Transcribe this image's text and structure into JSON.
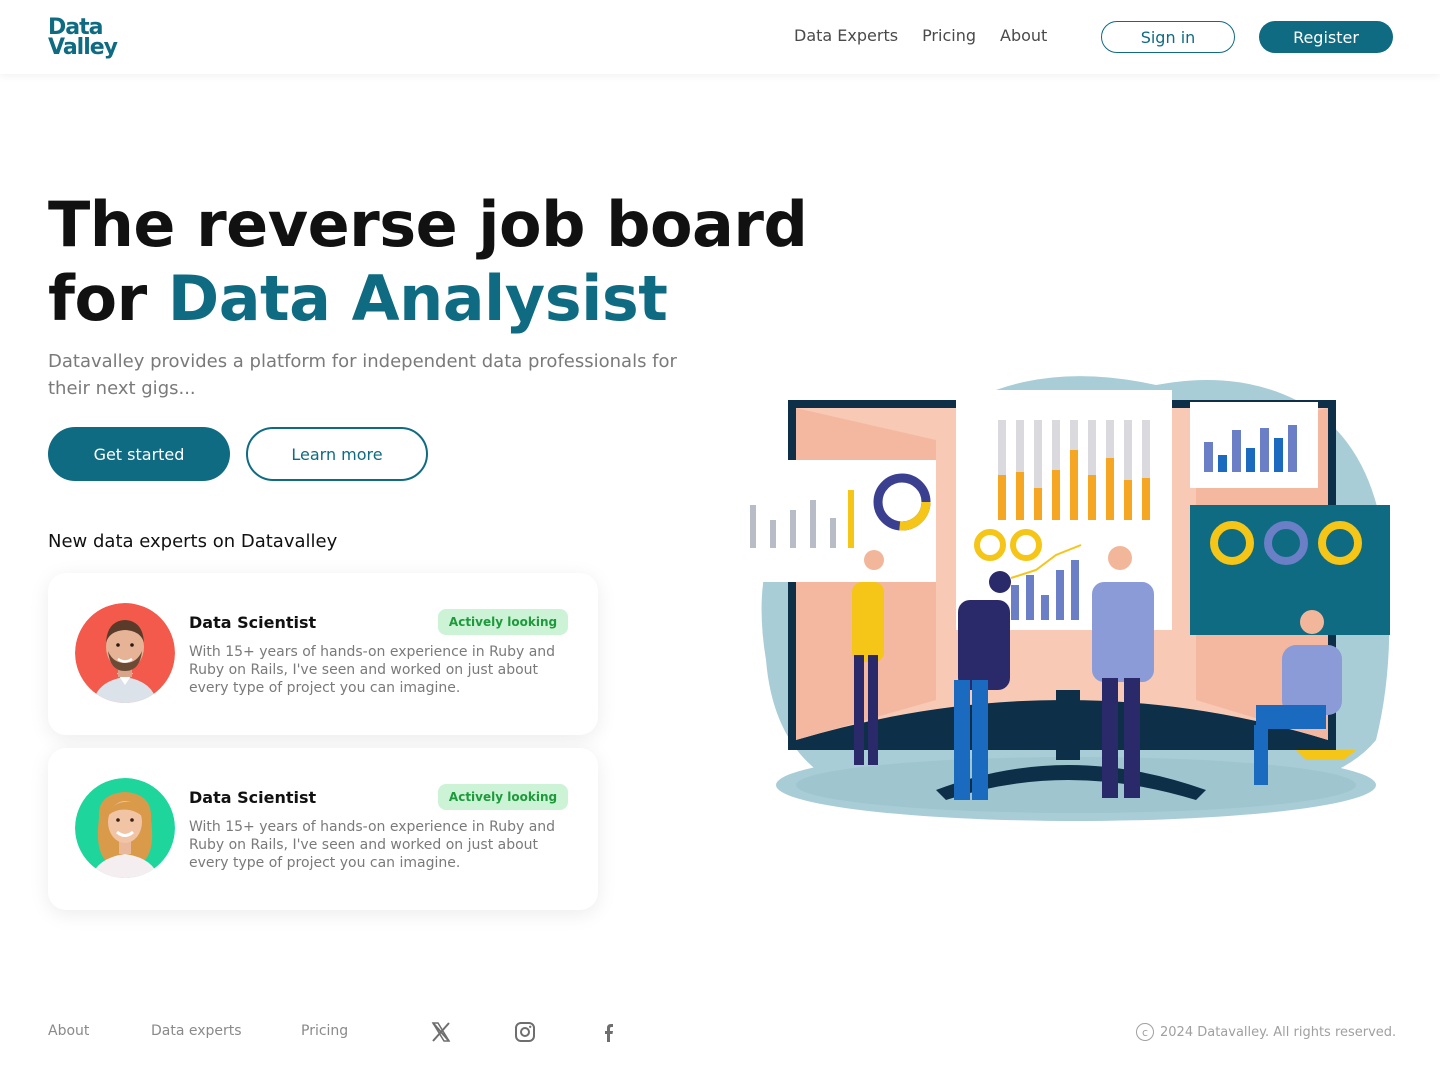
{
  "header": {
    "logo_line1": "Data",
    "logo_line2": "Valley",
    "nav": [
      "Data Experts",
      "Pricing",
      "About"
    ],
    "signin_label": "Sign in",
    "register_label": "Register"
  },
  "hero": {
    "title_line1": "The reverse job board",
    "title_for": "for ",
    "title_accent": "Data Analysist",
    "subtitle": "Datavalley provides a platform for independent data professionals for their next gigs...",
    "cta_primary": "Get started",
    "cta_secondary": "Learn more"
  },
  "experts": {
    "section_title": "New data experts on Datavalley",
    "cards": [
      {
        "role": "Data Scientist",
        "status": "Actively looking",
        "description": "With 15+ years of hands-on experience in Ruby and Ruby on Rails, I've seen and worked on just about every type of project you can imagine."
      },
      {
        "role": "Data Scientist",
        "status": "Actively looking",
        "description": "With 15+ years of hands-on experience in Ruby and Ruby on Rails, I've seen and worked on just about every type of project you can imagine."
      }
    ]
  },
  "footer": {
    "links": [
      "About",
      "Data experts",
      "Pricing"
    ],
    "social_icons": [
      "x-icon",
      "instagram-icon",
      "facebook-icon"
    ],
    "copyright": "2024 Datavalley. All rights reserved."
  },
  "colors": {
    "brand": "#0e6b82",
    "badge_bg": "#cdf3d6",
    "badge_text": "#1e9a3c"
  }
}
